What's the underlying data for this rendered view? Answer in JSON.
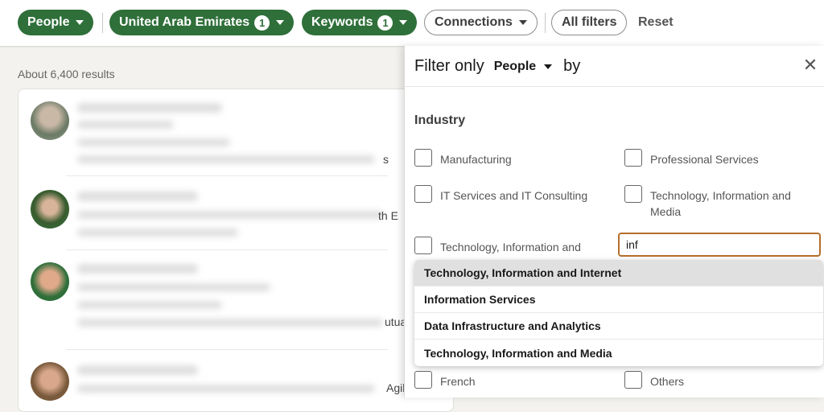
{
  "filters": {
    "people": "People",
    "location": "United Arab Emirates",
    "location_count": "1",
    "keywords": "Keywords",
    "keywords_count": "1",
    "connections": "Connections",
    "all_filters": "All filters",
    "reset": "Reset"
  },
  "results": {
    "count_text": "About 6,400 results",
    "clips": [
      "s",
      "th E",
      "utua",
      "Agil"
    ]
  },
  "panel": {
    "prefix": "Filter only",
    "type": "People",
    "suffix": "by",
    "section": "Industry",
    "options": [
      "Manufacturing",
      "Professional Services",
      "IT Services and IT Consulting",
      "Technology, Information and Media",
      "Technology, Information and",
      "French",
      "Others"
    ],
    "search_value": "inf",
    "suggestions": [
      "Technology, Information and Internet",
      "Information Services",
      "Data Infrastructure and Analytics",
      "Technology, Information and Media"
    ]
  },
  "colors": {
    "green": "#2f6f3a",
    "focus_border": "#b56e2c"
  }
}
